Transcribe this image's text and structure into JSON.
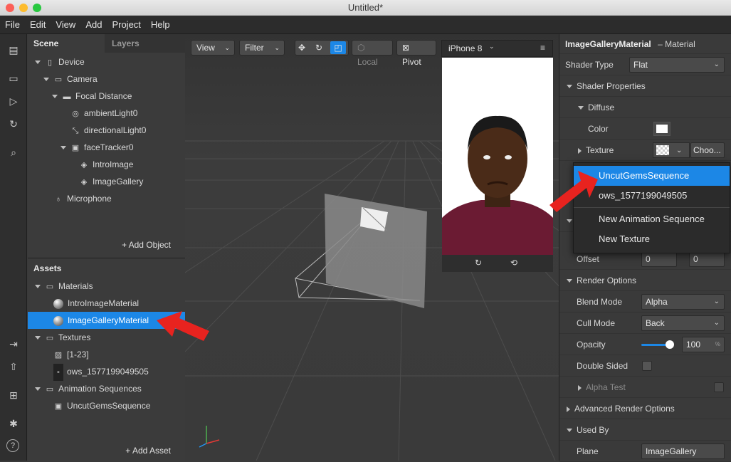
{
  "window": {
    "title": "Untitled*"
  },
  "menu": [
    "File",
    "Edit",
    "View",
    "Add",
    "Project",
    "Help"
  ],
  "scene": {
    "tab_scene": "Scene",
    "tab_layers": "Layers",
    "add_object": "+ Add Object",
    "items": [
      {
        "label": "Device"
      },
      {
        "label": "Camera"
      },
      {
        "label": "Focal Distance"
      },
      {
        "label": "ambientLight0"
      },
      {
        "label": "directionalLight0"
      },
      {
        "label": "faceTracker0"
      },
      {
        "label": "IntroImage"
      },
      {
        "label": "ImageGallery"
      },
      {
        "label": "Microphone"
      }
    ]
  },
  "assets": {
    "title": "Assets",
    "add_asset": "+ Add Asset",
    "items": [
      {
        "label": "Materials"
      },
      {
        "label": "IntroImageMaterial"
      },
      {
        "label": "ImageGalleryMaterial"
      },
      {
        "label": "Textures"
      },
      {
        "label": "[1-23]"
      },
      {
        "label": "ows_1577199049505"
      },
      {
        "label": "Animation Sequences"
      },
      {
        "label": "UncutGemsSequence"
      }
    ]
  },
  "viewport": {
    "view": "View",
    "filter": "Filter",
    "local": "Local",
    "pivot": "Pivot",
    "device": "iPhone 8"
  },
  "inspector": {
    "name": "ImageGalleryMaterial",
    "type": "– Material",
    "shader_type_label": "Shader Type",
    "shader_type": "Flat",
    "shader_props": "Shader Properties",
    "diffuse": "Diffuse",
    "color_label": "Color",
    "color": "#ffffff",
    "texture_label": "Texture",
    "choose": "Choo...",
    "offset_label": "Offset",
    "offset_x": "0",
    "offset_y": "0",
    "render_options": "Render Options",
    "blend_label": "Blend Mode",
    "blend": "Alpha",
    "cull_label": "Cull Mode",
    "cull": "Back",
    "opacity_label": "Opacity",
    "opacity": "100",
    "opacity_unit": "%",
    "opacity_fraction": 1.0,
    "double_sided": "Double Sided",
    "alpha_test": "Alpha Test",
    "adv_render": "Advanced Render Options",
    "used_by": "Used By",
    "plane_label": "Plane",
    "plane": "ImageGallery"
  },
  "dropdown": {
    "items": [
      "UncutGemsSequence",
      "ows_1577199049505",
      "New Animation Sequence",
      "New Texture"
    ]
  },
  "colors": {
    "accent": "#1c87e6",
    "arrow": "#e8231f"
  }
}
